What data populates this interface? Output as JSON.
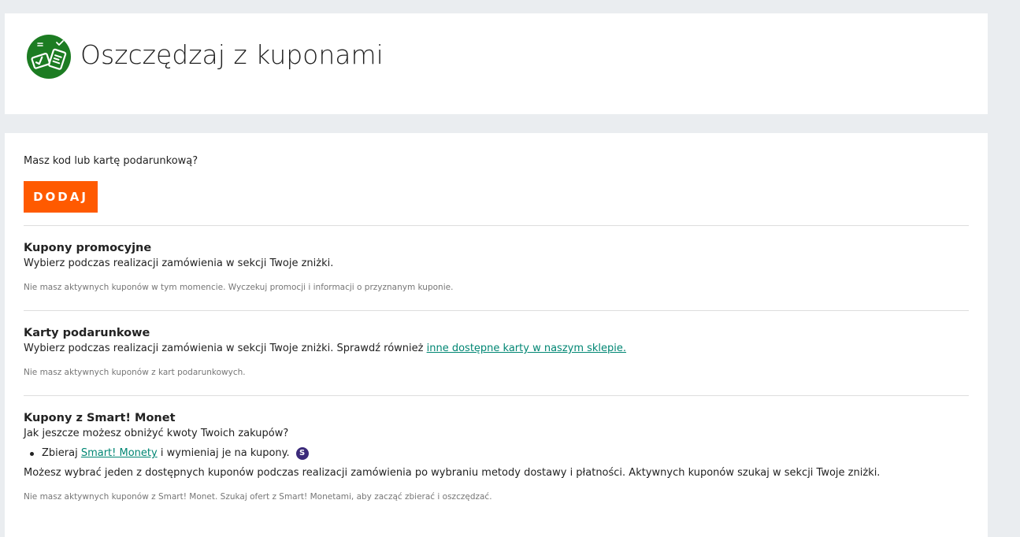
{
  "header": {
    "title": "Oszczędzaj z kuponami",
    "logo_icon": "coupons-logo-icon",
    "logo_color": "#1c7c22"
  },
  "add_code": {
    "question": "Masz kod lub kartę podarunkową?",
    "button_label": "DODAJ",
    "button_color": "#ff5a00"
  },
  "promo_coupons": {
    "title": "Kupony promocyjne",
    "text": "Wybierz podczas realizacji zamówienia w sekcji Twoje zniżki.",
    "note": "Nie masz aktywnych kuponów w tym momencie. Wyczekuj promocji i informacji o przyznanym kuponie."
  },
  "gift_cards": {
    "title": "Karty podarunkowe",
    "text": "Wybierz podczas realizacji zamówienia w sekcji Twoje zniżki. Sprawdź również ",
    "link_text": "inne dostępne karty w naszym sklepie.",
    "note": "Nie masz aktywnych kuponów z kart podarunkowych."
  },
  "smart_coupons": {
    "title": "Kupony z Smart! Monet",
    "question": "Jak jeszcze możesz obniżyć kwoty Twoich zakupów?",
    "bullet_prefix": "Zbieraj ",
    "bullet_link": "Smart! Monety",
    "bullet_suffix": " i wymieniaj je na kupony.",
    "coin_icon": "smart-coin-icon",
    "coin_letter": "S",
    "text": "Możesz wybrać jeden z dostępnych kuponów podczas realizacji zamówienia po wybraniu metody dostawy i płatności. Aktywnych kuponów szukaj w sekcji Twoje zniżki.",
    "note": "Nie masz aktywnych kuponów z Smart! Monet. Szukaj ofert z Smart! Monetami, aby zacząć zbierać i oszczędzać."
  },
  "colors": {
    "page_background": "#eaedf0",
    "card_background": "#ffffff",
    "link": "#008673",
    "muted_text": "#767676"
  }
}
